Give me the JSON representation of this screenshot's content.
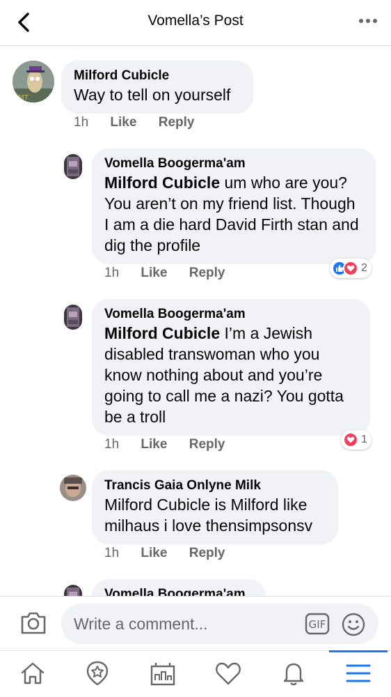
{
  "header": {
    "title": "Vomella’s Post",
    "back_icon": "chevron-left-icon",
    "more_icon": "more-dots-icon"
  },
  "comments": [
    {
      "author": "Milford Cubicle",
      "mention": "",
      "text": "Way to tell on yourself",
      "time": "1h",
      "like_label": "Like",
      "reply_label": "Reply",
      "reactions": null
    },
    {
      "author": "Vomella Boogerma'am",
      "mention": "Milford Cubicle",
      "text": " um who are you? You aren’t on my friend list. Though I am a die hard David Firth stan and dig the profile",
      "time": "1h",
      "like_label": "Like",
      "reply_label": "Reply",
      "reactions": {
        "types": [
          "like",
          "love"
        ],
        "count": "2"
      }
    },
    {
      "author": "Vomella Boogerma'am",
      "mention": "Milford Cubicle",
      "text": " I’m a Jewish disabled transwoman who you know nothing about and you’re going to call me a nazi? You gotta be a troll",
      "time": "1h",
      "like_label": "Like",
      "reply_label": "Reply",
      "reactions": {
        "types": [
          "love"
        ],
        "count": "1"
      }
    },
    {
      "author": "Trancis Gaia Onlyne Milk",
      "mention": "",
      "text": "Milford Cubicle is Milford like milhaus i love thensimpsonsv",
      "time": "1h",
      "like_label": "Like",
      "reply_label": "Reply",
      "reactions": null
    },
    {
      "author": "Vomella Boogerma'am",
      "mention": "",
      "text": "",
      "time": "",
      "like_label": "",
      "reply_label": "",
      "reactions": null
    }
  ],
  "composer": {
    "placeholder": "Write a comment...",
    "gif_label": "GIF"
  },
  "tabbar": {
    "items": [
      "home-icon",
      "marketplace-icon",
      "pages-icon",
      "dating-heart-icon",
      "notifications-bell-icon",
      "menu-icon"
    ],
    "active": "menu-icon"
  },
  "colors": {
    "accent": "#1877f2",
    "love": "#f33e58",
    "bubble": "#f0f2f5",
    "meta_text": "#65676b"
  }
}
